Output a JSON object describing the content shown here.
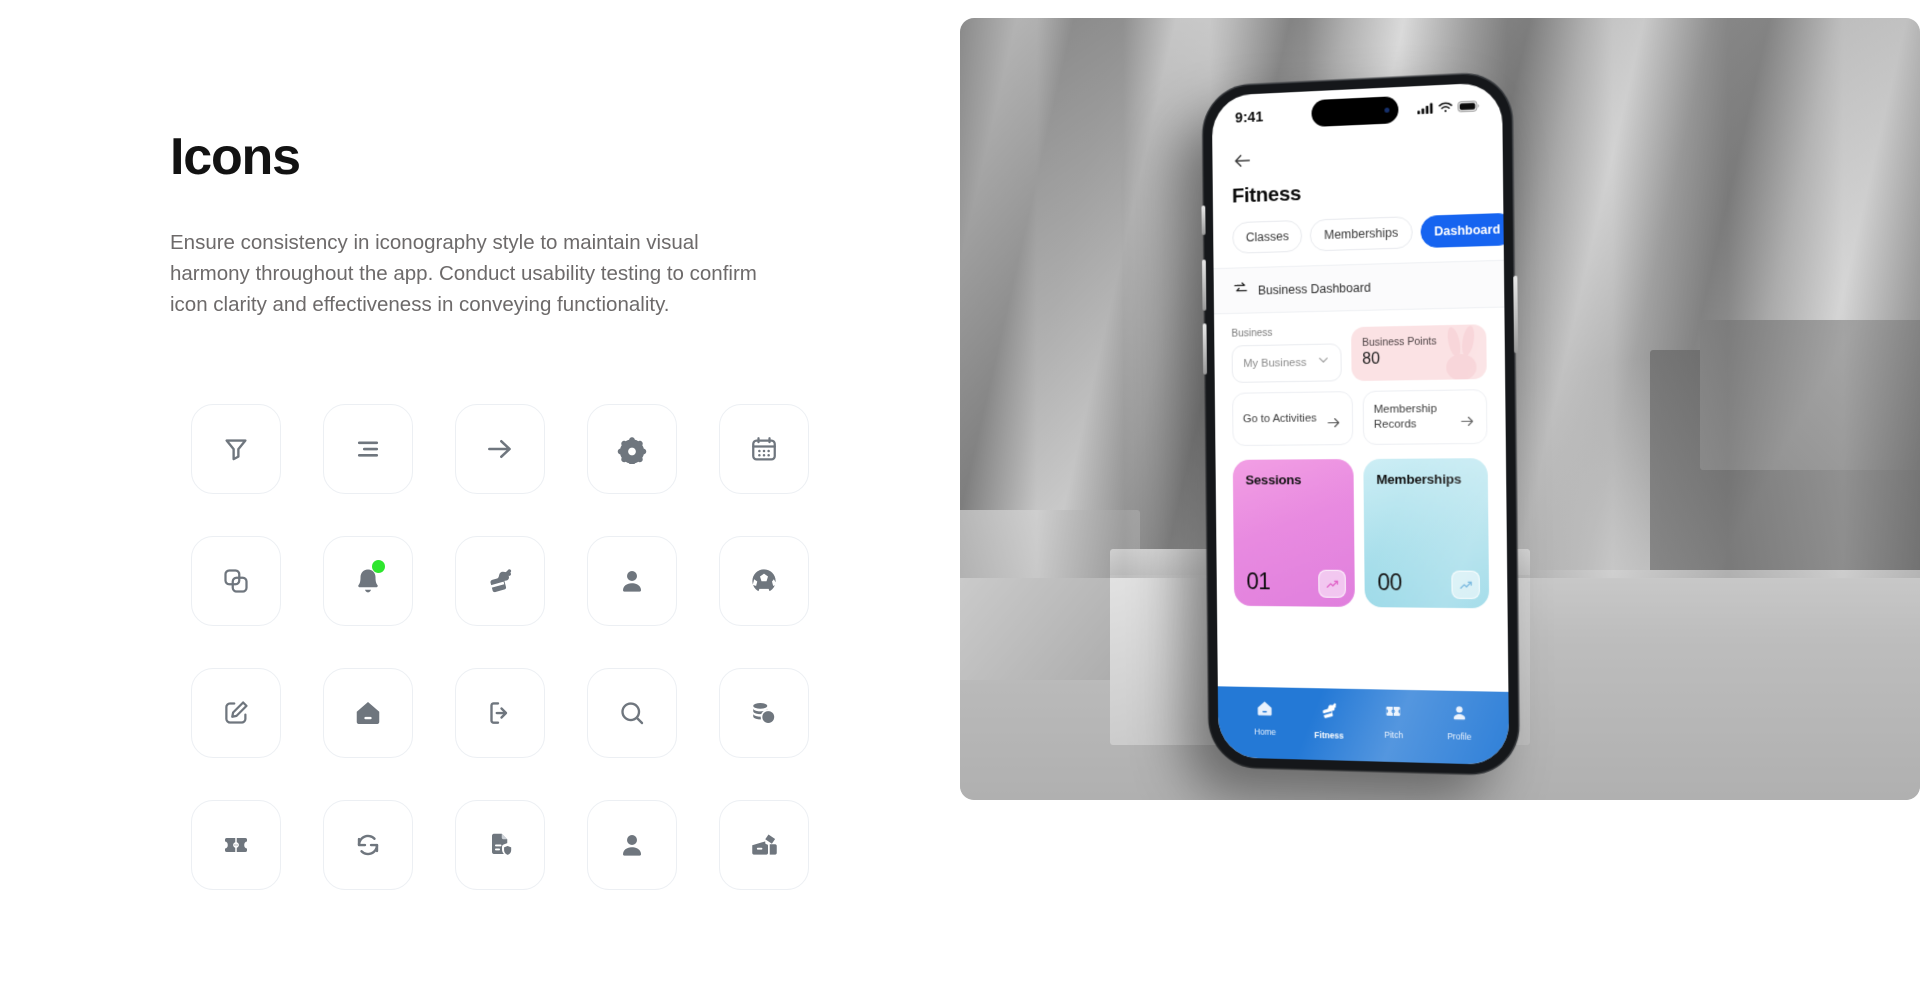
{
  "doc": {
    "title": "Icons",
    "description": "Ensure consistency in iconography style to maintain visual harmony throughout the app. Conduct usability testing to confirm icon clarity and effectiveness in conveying functionality."
  },
  "icon_grid": {
    "rows": 4,
    "columns": 5,
    "items": [
      {
        "name": "filter-icon",
        "style": "outline"
      },
      {
        "name": "menu-align-right-icon",
        "style": "outline"
      },
      {
        "name": "arrow-right-icon",
        "style": "outline"
      },
      {
        "name": "gear-icon",
        "style": "solid"
      },
      {
        "name": "calendar-icon",
        "style": "outline"
      },
      {
        "name": "copy-icon",
        "style": "outline"
      },
      {
        "name": "bell-notification-icon",
        "style": "solid",
        "badge_color": "#2ee62e"
      },
      {
        "name": "muscle-flex-icon",
        "style": "solid"
      },
      {
        "name": "person-icon",
        "style": "solid"
      },
      {
        "name": "soccer-ball-icon",
        "style": "solid"
      },
      {
        "name": "edit-pencil-icon",
        "style": "outline"
      },
      {
        "name": "home-icon",
        "style": "solid"
      },
      {
        "name": "logout-icon",
        "style": "outline"
      },
      {
        "name": "search-icon",
        "style": "outline"
      },
      {
        "name": "coins-icon",
        "style": "solid"
      },
      {
        "name": "pitch-field-icon",
        "style": "solid"
      },
      {
        "name": "refresh-icon",
        "style": "outline"
      },
      {
        "name": "document-shield-icon",
        "style": "solid"
      },
      {
        "name": "person-filled-icon",
        "style": "solid"
      },
      {
        "name": "tickets-icon",
        "style": "solid"
      }
    ]
  },
  "phone": {
    "status_bar": {
      "time": "9:41",
      "signal_icon": "cellular-signal-icon",
      "wifi_icon": "wifi-icon",
      "battery_icon": "battery-icon"
    },
    "header": {
      "back_icon": "arrow-left-icon",
      "title": "Fitness"
    },
    "tabs": [
      {
        "label": "Classes",
        "active": false
      },
      {
        "label": "Memberships",
        "active": false
      },
      {
        "label": "Dashboard",
        "active": true
      }
    ],
    "section_bar": {
      "icon": "switch-arrows-icon",
      "label": "Business Dashboard"
    },
    "business_select": {
      "label": "Business",
      "value": "My Business",
      "chevron_icon": "chevron-down-icon"
    },
    "points_card": {
      "label": "Business Points",
      "value": "80",
      "watermark_icon": "rabbit-icon",
      "background": "#fbe2e4"
    },
    "link_cards": [
      {
        "label": "Go to Activities",
        "arrow_icon": "arrow-right-icon"
      },
      {
        "label": "Membership Records",
        "arrow_icon": "arrow-right-icon"
      }
    ],
    "stat_cards": [
      {
        "title": "Sessions",
        "value": "01",
        "accent": "#e88ae0",
        "trend_icon": "trend-up-icon"
      },
      {
        "title": "Memberships",
        "value": "00",
        "accent": "#a9dfeb",
        "trend_icon": "trend-up-icon"
      }
    ],
    "bottom_nav": {
      "background": "#2479d6",
      "items": [
        {
          "label": "Home",
          "icon": "home-icon",
          "active": false
        },
        {
          "label": "Fitness",
          "icon": "muscle-flex-icon",
          "active": true
        },
        {
          "label": "Pitch",
          "icon": "pitch-field-icon",
          "active": false
        },
        {
          "label": "Profile",
          "icon": "person-icon",
          "active": false
        }
      ]
    }
  },
  "theme": {
    "accent_blue": "#1664f0",
    "nav_blue": "#2479d6",
    "icon_gray": "#6f767e",
    "tile_border": "#eceff3",
    "text_primary": "#121212",
    "text_secondary": "#6d6a6a"
  }
}
